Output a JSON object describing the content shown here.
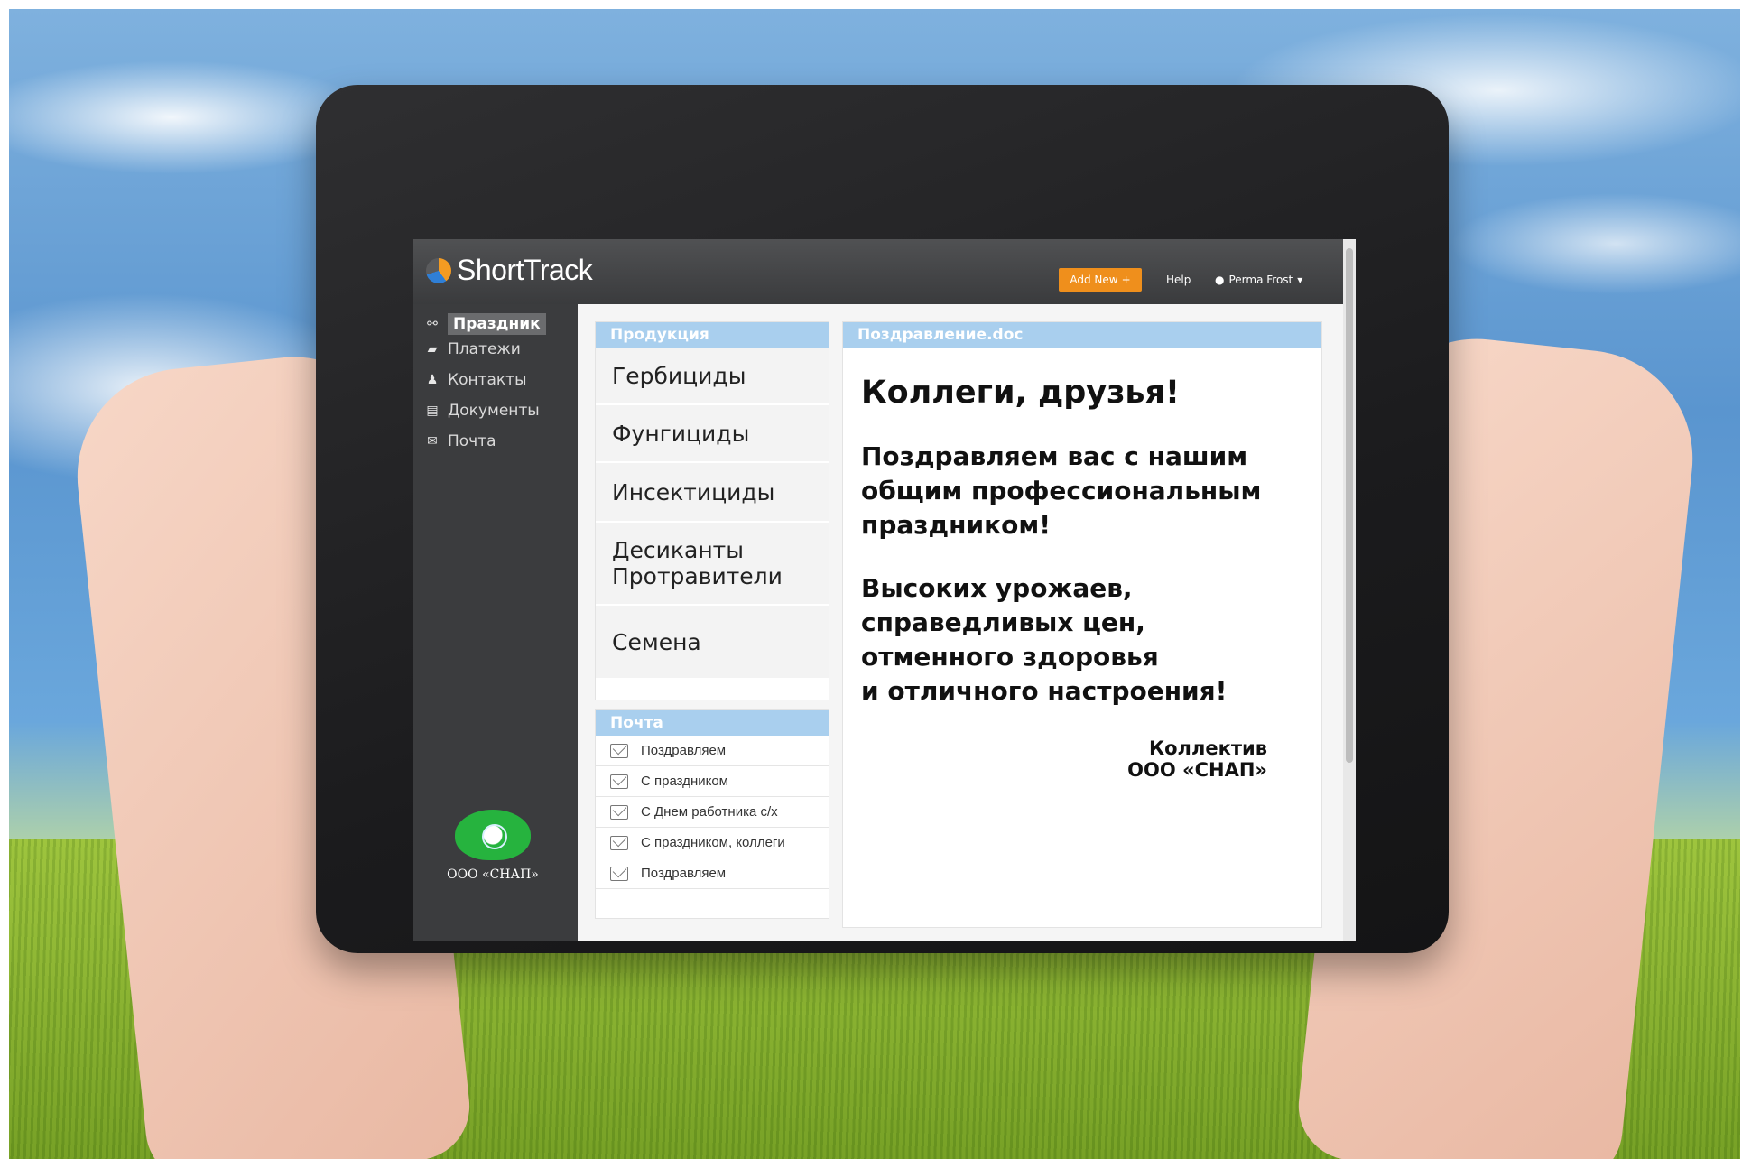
{
  "app": {
    "brand": "ShortTrack",
    "add_new": "Add New",
    "help": "Help",
    "user": "Perma Frost"
  },
  "sidebar": {
    "items": [
      {
        "label": "Праздник",
        "icon": "user-icon",
        "active": true
      },
      {
        "label": "Платежи",
        "icon": "folder-icon",
        "active": false
      },
      {
        "label": "Контакты",
        "icon": "person-icon",
        "active": false
      },
      {
        "label": "Документы",
        "icon": "document-icon",
        "active": false
      },
      {
        "label": "Почта",
        "icon": "mail-icon",
        "active": false
      }
    ],
    "company": "ООО «СНАП»"
  },
  "products": {
    "title": "Продукция",
    "items": [
      "Гербициды",
      "Фунгициды",
      "Инсектициды",
      "Десиканты",
      "Протравители",
      "Семена"
    ]
  },
  "mail": {
    "title": "Почта",
    "items": [
      "Поздравляем",
      "С праздником",
      "С Днем работника с/х",
      "С праздником, коллеги",
      "Поздравляем"
    ]
  },
  "document": {
    "title": "Поздравление.doc",
    "heading": "Коллеги, друзья!",
    "paragraph1": "Поздравляем вас с нашим общим профессиональным праздником!",
    "paragraph2_lines": [
      "Высоких урожаев,",
      "справедливых цен,",
      "отменного здоровья",
      "и отличного настроения!"
    ],
    "signature_line1": "Коллектив",
    "signature_line2": "ООО «СНАП»"
  },
  "colors": {
    "accent": "#ef8f1c",
    "panel_header": "#a9cfee",
    "sidebar": "#3b3c3e"
  }
}
